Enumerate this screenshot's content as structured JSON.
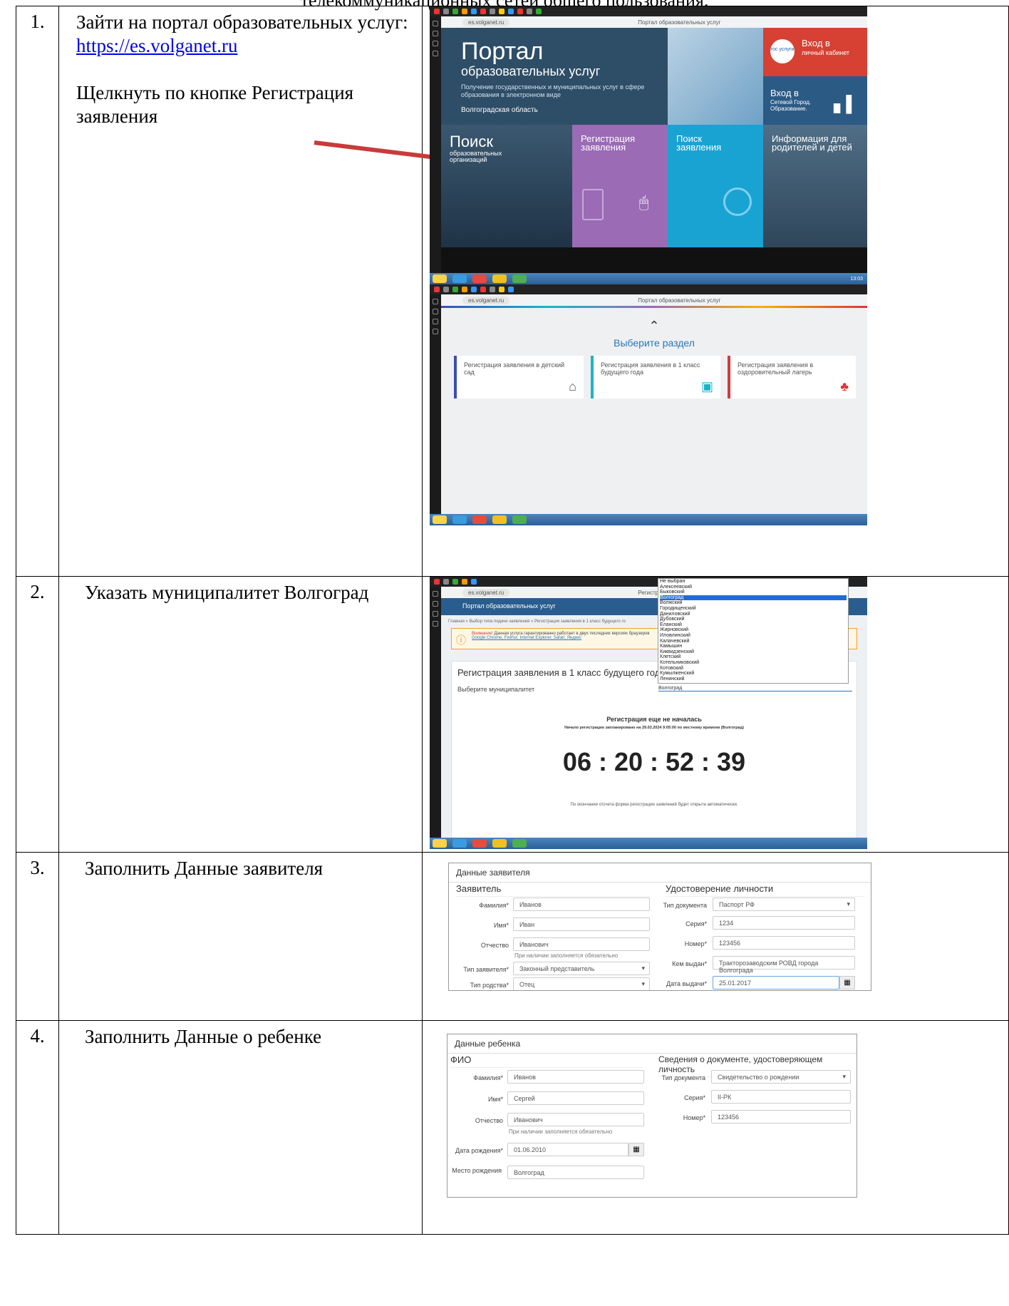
{
  "page": {
    "title_fragment": "телекоммуникационных сетей общего пользования."
  },
  "rows": [
    {
      "num": "1.",
      "text_before_link": "Зайти на портал образовательных услуг: ",
      "link": "https://es.volganet.ru",
      "text2": "Щелкнуть по кнопке Регистрация заявления"
    },
    {
      "num": "2.",
      "text": "Указать муниципалитет Волгоград"
    },
    {
      "num": "3.",
      "text": "Заполнить Данные заявителя"
    },
    {
      "num": "4.",
      "text": "Заполнить Данные о ребенке"
    }
  ],
  "shot1": {
    "address": "es.volganet.ru",
    "tab_title": "Портал образовательных услуг",
    "hero_title": "Портал",
    "hero_sub": "образовательных услуг",
    "hero_desc": "Получение государственных и муниципальных услуг в сфере образования в электронном виде",
    "region": "Волгоградская область",
    "login_gos": "Вход в",
    "login_gos2": "личный кабинет",
    "gos_logo": "гос услуги",
    "login_net": "Вход в",
    "login_net2": "Сетевой Город. Образование.",
    "tile_search": "Поиск",
    "tile_search_sub": "образовательных организаций",
    "tile_reg": "Регистрация заявления",
    "tile_find": "Поиск заявления",
    "tile_info": "Информация для родителей и детей",
    "clock": "13:03"
  },
  "shot2": {
    "address": "es.volganet.ru",
    "tab_title": "Портал образовательных услуг",
    "choose": "Выберите раздел",
    "cards": [
      {
        "label": "Регистрация заявления в детский сад",
        "color": "#3b4fb0"
      },
      {
        "label": "Регистрация заявления в 1 класс будущего года",
        "color": "#19b5c7"
      },
      {
        "label": "Регистрация заявления в оздоровительный лагерь",
        "color": "#d9383a"
      }
    ]
  },
  "shot3": {
    "tab_title": "Регистрация заявления | Портал",
    "portal": "Портал образовательных услуг",
    "crumbs": "Главная  »  Выбор типа подачи заявления  »  Регистрация заявления в 1 класс будущего го",
    "warning_bold": "Внимание!",
    "warning": "Данная услуга гарантированно работает в двух последних версиях браузеров",
    "browsers": "Google Chrome, Firefox, Internet Explorer, Safari, Яндекс",
    "panel_title": "Регистрация заявления в 1 класс будущего год",
    "choose_mun": "Выберите муниципалитет",
    "selected": "Волгоград",
    "not_started": "Регистрация еще не началась",
    "planned": "Начало регистрации запланировано на 29.03.2024 9:05:00 по местному времени (Волгоград)",
    "countdown": "06 : 20 : 52 : 39",
    "after": "По окончании отсчета форма регистрации заявлений будет открыта автоматически.",
    "options": [
      "Не выбран",
      "Алексеевский",
      "Быковский",
      "Волгоград",
      "Волжский",
      "Городищенский",
      "Даниловский",
      "Дубовский",
      "Еланский",
      "Жирновский",
      "Иловлинский",
      "Калачевский",
      "Камышин",
      "Киквидзенский",
      "Клетский",
      "Котельниковский",
      "Котовский",
      "Кумылженский",
      "Ленинский"
    ]
  },
  "form1": {
    "title": "Данные заявителя",
    "left_section": "Заявитель",
    "right_section": "Удостоверение личности",
    "last_name_label": "Фамилия*",
    "last_name": "Иванов",
    "first_name_label": "Имя*",
    "first_name": "Иван",
    "patronymic_label": "Отчество",
    "patronymic": "Иванович",
    "hint": "При наличии заполняется обязательно",
    "applicant_type_label": "Тип заявителя*",
    "applicant_type": "Законный представитель",
    "relation_label": "Тип родства*",
    "relation": "Отец",
    "doc_type_label": "Тип документа",
    "doc_type": "Паспорт РФ",
    "series_label": "Серия*",
    "series": "1234",
    "number_label": "Номер*",
    "number": "123456",
    "issued_by_label": "Кем выдан*",
    "issued_by": "Тракторозаводским РОВД города Волгограда",
    "issue_date_label": "Дата выдачи*",
    "issue_date": "25.01.2017"
  },
  "form2": {
    "title": "Данные ребенка",
    "left_section": "ФИО",
    "right_section": "Сведения о документе, удостоверяющем личность",
    "last_name_label": "Фамилия*",
    "last_name": "Иванов",
    "first_name_label": "Имя*",
    "first_name": "Сергей",
    "patronymic_label": "Отчество",
    "patronymic": "Иванович",
    "hint": "При наличии заполняется обязательно",
    "birth_date_label": "Дата рождения*",
    "birth_date": "01.06.2010",
    "birth_place_label": "Место рождения",
    "birth_place": "Волгоград",
    "doc_type_label": "Тип документа",
    "doc_type": "Свидетельство о рождении",
    "series_label": "Серия*",
    "series": "II-РК",
    "number_label": "Номер*",
    "number": "123456"
  }
}
